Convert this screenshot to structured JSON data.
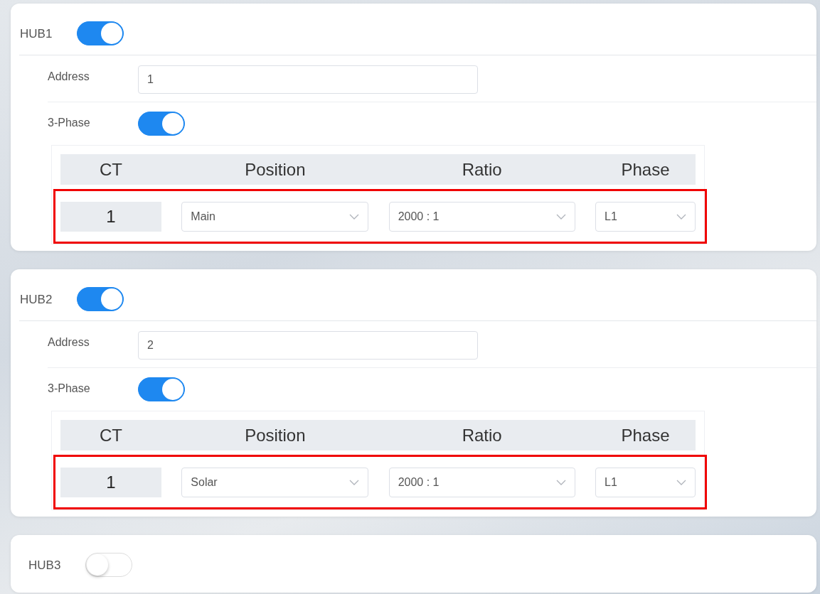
{
  "hubs": [
    {
      "name": "HUB1",
      "enabled": true,
      "address_label": "Address",
      "address": "1",
      "three_phase_label": "3-Phase",
      "three_phase": true,
      "table": {
        "columns": [
          "CT",
          "Position",
          "Ratio",
          "Phase"
        ],
        "rows": [
          {
            "ct": "1",
            "position": "Main",
            "ratio": "2000 : 1",
            "phase": "L1",
            "highlighted": true
          }
        ]
      }
    },
    {
      "name": "HUB2",
      "enabled": true,
      "address_label": "Address",
      "address": "2",
      "three_phase_label": "3-Phase",
      "three_phase": true,
      "table": {
        "columns": [
          "CT",
          "Position",
          "Ratio",
          "Phase"
        ],
        "rows": [
          {
            "ct": "1",
            "position": "Solar",
            "ratio": "2000 : 1",
            "phase": "L1",
            "highlighted": true
          }
        ]
      }
    },
    {
      "name": "HUB3",
      "enabled": false
    }
  ]
}
